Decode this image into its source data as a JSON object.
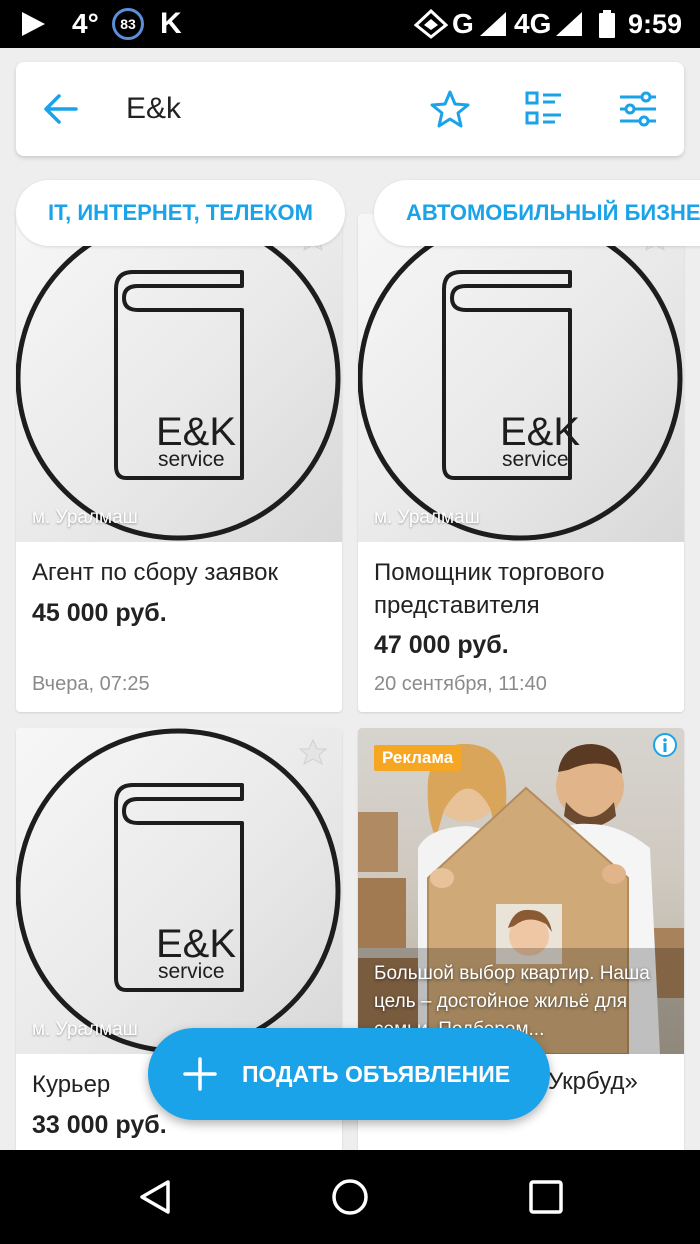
{
  "status_bar": {
    "temperature": "4°",
    "badge": "83",
    "app_letter": "K",
    "network": "G",
    "network_4g": "4G",
    "time": "9:59"
  },
  "header": {
    "query": "E&k",
    "icons": [
      "back-arrow-icon",
      "star-icon",
      "list-view-icon",
      "filter-icon"
    ]
  },
  "chips": [
    {
      "label": "IT, ИНТЕРНЕТ, ТЕЛЕКОМ"
    },
    {
      "label": "АВТОМОБИЛЬНЫЙ БИЗНЕС"
    }
  ],
  "listings": [
    {
      "logo_text": "E&K",
      "logo_sub": "service",
      "metro": "м. Уралмаш",
      "title": "Агент по сбору заявок",
      "price": "45 000 руб.",
      "date": "Вчера, 07:25"
    },
    {
      "logo_text": "E&K",
      "logo_sub": "service",
      "metro": "м. Уралмаш",
      "title": "Помощник торгового представителя",
      "price": "47 000 руб.",
      "date": "20 сентября, 11:40"
    },
    {
      "logo_text": "E&K",
      "logo_sub": "service",
      "metro": "м. Уралмаш",
      "title": "Курьер",
      "price": "33 000 руб.",
      "date": ""
    }
  ],
  "ad": {
    "label": "Реклама",
    "text": "Большой выбор квартир. Наша цель – достойное жильё для семьи. Подберем...",
    "title": "Укрбуд»"
  },
  "fab": {
    "label": "ПОДАТЬ ОБЪЯВЛЕНИЕ"
  },
  "colors": {
    "accent": "#1aa3e8",
    "ad_label": "#f5a623"
  }
}
